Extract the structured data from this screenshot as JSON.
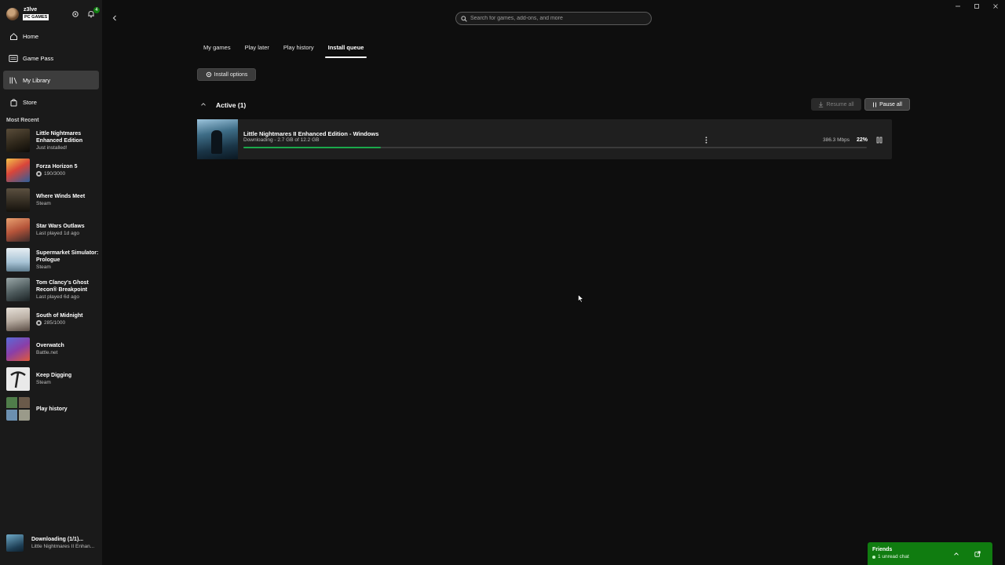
{
  "profile": {
    "gamertag": "z3lve",
    "badge": "PC GAMES",
    "notifications": "4"
  },
  "nav": [
    {
      "label": "Home",
      "icon": "home-icon"
    },
    {
      "label": "Game Pass",
      "icon": "game-pass-icon"
    },
    {
      "label": "My Library",
      "icon": "library-icon"
    },
    {
      "label": "Store",
      "icon": "store-icon"
    }
  ],
  "most_recent_title": "Most Recent",
  "recent": [
    {
      "name": "Little Nightmares Enhanced Edition",
      "sub": "Just installed!"
    },
    {
      "name": "Forza Horizon 5",
      "sub": "190/3000"
    },
    {
      "name": "Where Winds Meet",
      "sub": "Steam"
    },
    {
      "name": "Star Wars Outlaws",
      "sub": "Last played 1d ago"
    },
    {
      "name": "Supermarket Simulator: Prologue",
      "sub": "Steam"
    },
    {
      "name": "Tom Clancy's Ghost Recon® Breakpoint",
      "sub": "Last played 6d ago"
    },
    {
      "name": "South of Midnight",
      "sub": "285/1000"
    },
    {
      "name": "Overwatch",
      "sub": "Battle.net"
    },
    {
      "name": "Keep Digging",
      "sub": "Steam"
    },
    {
      "name": "Play history",
      "sub": ""
    }
  ],
  "download_status": {
    "title": "Downloading (1/1)...",
    "sub": "Little Nightmares II Enhan..."
  },
  "search": {
    "placeholder": "Search for games, add-ons, and more"
  },
  "tabs": [
    {
      "label": "My games"
    },
    {
      "label": "Play later"
    },
    {
      "label": "Play history"
    },
    {
      "label": "Install queue"
    }
  ],
  "install_options": "Install options",
  "section": {
    "title": "Active (1)",
    "resume_all": "Resume all",
    "pause_all": "Pause all"
  },
  "queue_item": {
    "title": "Little Nightmares II Enhanced Edition - Windows",
    "status": "Downloading - 2.7 GB of 12.2 GB",
    "speed": "386.3 Mbps",
    "percent": "22%",
    "progress": 0.22
  },
  "friends": {
    "title": "Friends",
    "sub": "1 unread chat"
  },
  "colors": {
    "accent": "#107c10",
    "progress": "#1aa84b",
    "active_nav": "#3d3d3d"
  }
}
